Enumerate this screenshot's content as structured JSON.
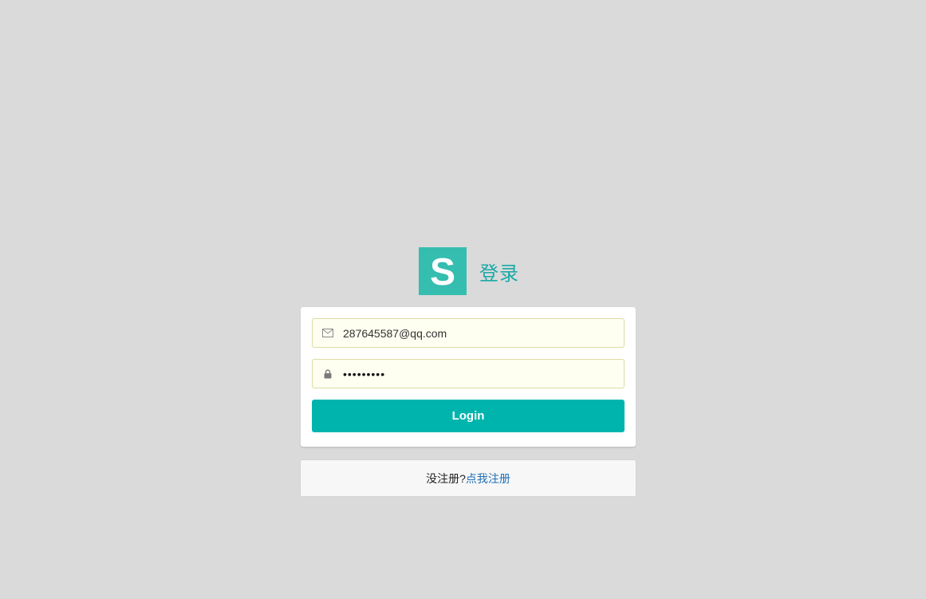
{
  "header": {
    "logo_letter": "S",
    "title": "登录"
  },
  "login_form": {
    "email_value": "287645587@qq.com",
    "email_icon": "envelope-icon",
    "password_mask": "•••••••••",
    "password_icon": "lock-icon",
    "login_label": "Login"
  },
  "register": {
    "prompt": "没注册?",
    "link_label": "点我注册"
  },
  "colors": {
    "background": "#dadada",
    "accent": "#00b4ae",
    "logo": "#35bdb0",
    "input_bg": "#fefff0",
    "link": "#1e6fb5"
  }
}
